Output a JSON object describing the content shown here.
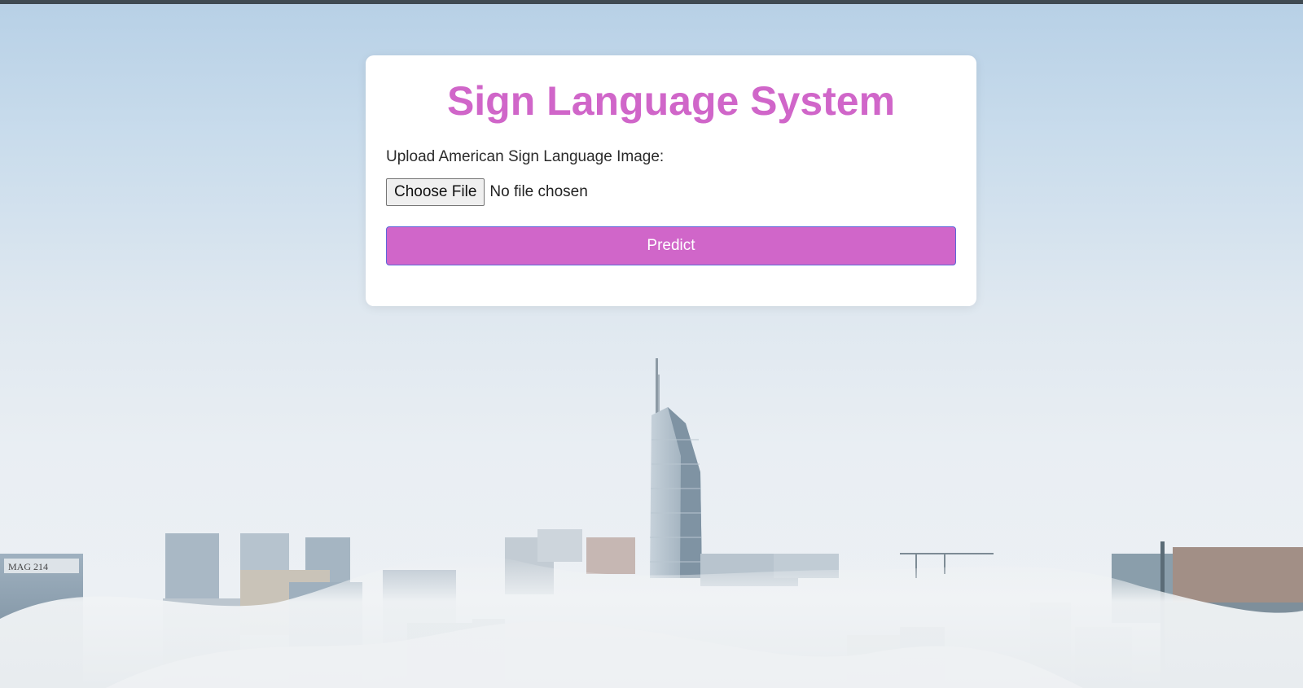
{
  "page": {
    "title": "Sign Language System",
    "upload_label": "Upload American Sign Language Image:",
    "file_button_label": "Choose File",
    "file_status": "No file chosen",
    "predict_label": "Predict"
  },
  "colors": {
    "accent": "#d066c9",
    "predict_border": "#5d66d8",
    "topbar": "#3f4a52",
    "sky_top": "#b7d0e6",
    "sky_bottom": "#eef1f4"
  },
  "background": {
    "sign_text": "MAG 214"
  }
}
